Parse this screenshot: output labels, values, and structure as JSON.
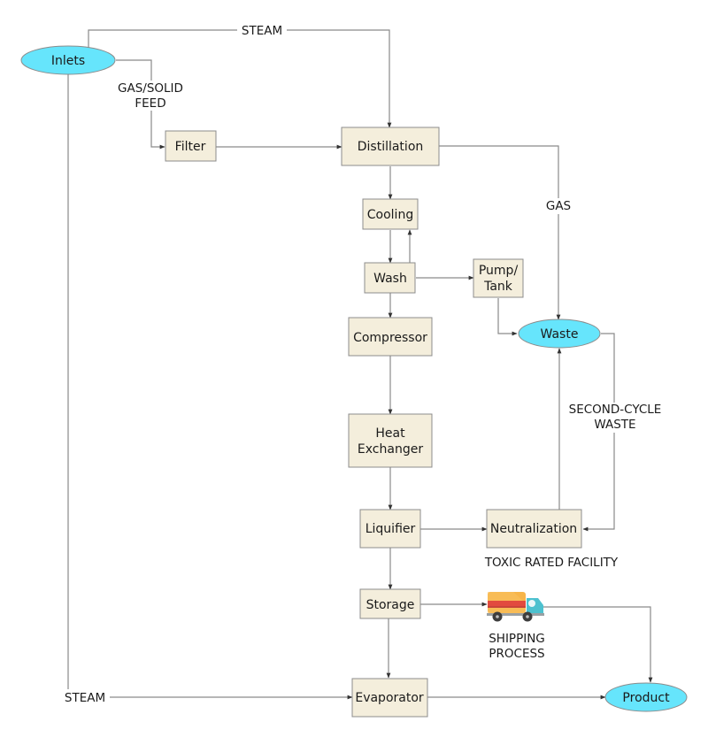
{
  "diagram": {
    "type": "process-flow",
    "colors": {
      "terminal_fill": "#66e5fc",
      "process_fill": "#f4eedc",
      "border": "#8c8c8c",
      "edge": "#8a8a8a"
    },
    "nodes": {
      "inlets": {
        "label": "Inlets",
        "shape": "ellipse"
      },
      "filter": {
        "label": "Filter",
        "shape": "box"
      },
      "distillation": {
        "label": "Distillation",
        "shape": "box"
      },
      "cooling": {
        "label": "Cooling",
        "shape": "box"
      },
      "wash": {
        "label": "Wash",
        "shape": "box"
      },
      "pump_tank": {
        "label_line1": "Pump/",
        "label_line2": "Tank",
        "shape": "box"
      },
      "waste": {
        "label": "Waste",
        "shape": "ellipse"
      },
      "compressor": {
        "label": "Compressor",
        "shape": "box"
      },
      "heat_exchanger": {
        "label_line1": "Heat",
        "label_line2": "Exchanger",
        "shape": "box"
      },
      "liquifier": {
        "label": "Liquifier",
        "shape": "box"
      },
      "neutralization": {
        "label": "Neutralization",
        "shape": "box"
      },
      "storage": {
        "label": "Storage",
        "shape": "box"
      },
      "evaporator": {
        "label": "Evaporator",
        "shape": "box"
      },
      "product": {
        "label": "Product",
        "shape": "ellipse"
      },
      "shipping": {
        "icon": "truck-icon"
      }
    },
    "labels": {
      "steam_top": "STEAM",
      "steam_bottom": "STEAM",
      "gas_solid_feed_line1": "GAS/SOLID",
      "gas_solid_feed_line2": "FEED",
      "gas": "GAS",
      "second_cycle_line1": "SECOND-CYCLE",
      "second_cycle_line2": "WASTE",
      "toxic_rated_facility": "TOXIC RATED FACILITY",
      "shipping_line1": "SHIPPING",
      "shipping_line2": "PROCESS"
    },
    "edges": [
      {
        "from": "inlets",
        "to": "distillation",
        "label": "STEAM"
      },
      {
        "from": "inlets",
        "to": "filter",
        "label": "GAS/SOLID FEED"
      },
      {
        "from": "inlets",
        "to": "evaporator",
        "label": "STEAM"
      },
      {
        "from": "filter",
        "to": "distillation"
      },
      {
        "from": "distillation",
        "to": "cooling"
      },
      {
        "from": "distillation",
        "to": "waste",
        "label": "GAS"
      },
      {
        "from": "cooling",
        "to": "wash"
      },
      {
        "from": "wash",
        "to": "cooling"
      },
      {
        "from": "wash",
        "to": "pump_tank"
      },
      {
        "from": "wash",
        "to": "compressor"
      },
      {
        "from": "pump_tank",
        "to": "waste"
      },
      {
        "from": "waste",
        "to": "neutralization",
        "label": "SECOND-CYCLE WASTE"
      },
      {
        "from": "neutralization",
        "to": "waste"
      },
      {
        "from": "compressor",
        "to": "heat_exchanger"
      },
      {
        "from": "heat_exchanger",
        "to": "liquifier"
      },
      {
        "from": "liquifier",
        "to": "neutralization"
      },
      {
        "from": "liquifier",
        "to": "storage"
      },
      {
        "from": "storage",
        "to": "shipping"
      },
      {
        "from": "storage",
        "to": "evaporator"
      },
      {
        "from": "shipping",
        "to": "product"
      },
      {
        "from": "evaporator",
        "to": "product"
      }
    ]
  }
}
